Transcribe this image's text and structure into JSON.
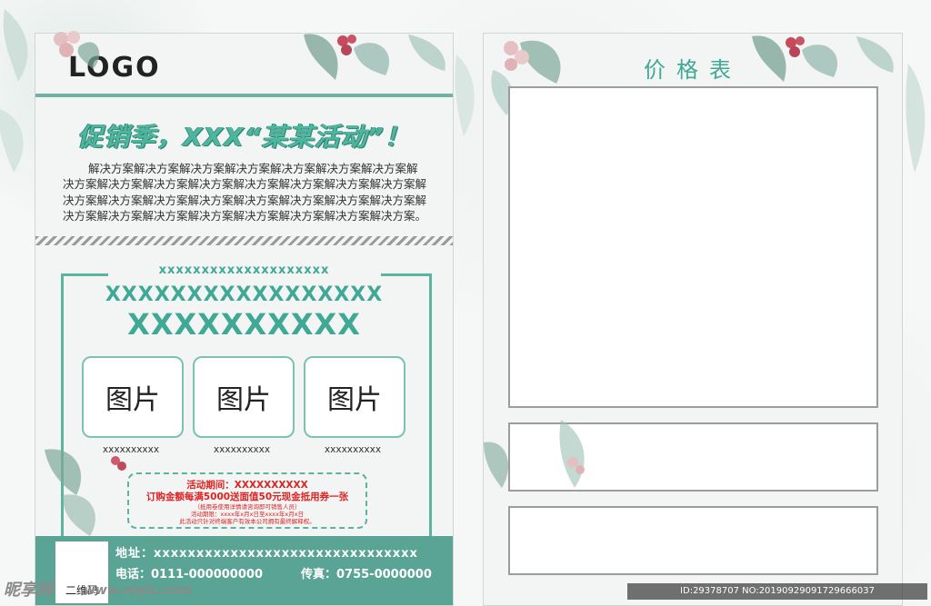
{
  "colors": {
    "accent": "#5bb3a0",
    "accent_dark": "#3fa995",
    "footer": "#5aa495",
    "coupon_text": "#dd2222"
  },
  "left": {
    "logo": "LOGO",
    "promo_title": "促销季，XXX“某某活动”！",
    "paragraph": "解决方案解决方案解决方案解决方案解决方案解决方案解决方案解决方案解决方案解决方案解决方案解决方案解决方案解决方案解决方案解决方案解决方案解决方案解决方案解决方案解决方案解决方案解决方案解决方案解决方案解决方案解决方案解决方案解决方案解决方案解决方案。",
    "x_line_1": "xxxxxxxxxxxxxxxxxxxx",
    "x_line_2": "XXXXXXXXXXXXXXXXX",
    "x_line_3": "XXXXXXXXXX",
    "pictures": [
      {
        "label": "图片",
        "caption": "xxxxxxxxxx"
      },
      {
        "label": "图片",
        "caption": "xxxxxxxxxx"
      },
      {
        "label": "图片",
        "caption": "xxxxxxxxxx"
      }
    ],
    "coupon": {
      "line1": "活动期间：XXXXXXXXXX",
      "line2": "订购金额每满5000送面值50元现金抵用券一张",
      "line3": "（抵用卷使用详情请咨询即可销售人员）",
      "line4": "活动期限：xxxx年x月x日至xxxx年x月x日",
      "line5": "此活动只针对终端客户有效本公司拥有最终解释权。"
    },
    "footer": {
      "qr_label": "二维码",
      "address": "地址：xxxxxxxxxxxxxxxxxxxxxxxxxxxxxxx",
      "phone": "电话：0111-000000000",
      "fax": "传真：0755-0000000"
    }
  },
  "right": {
    "title": "价格表"
  },
  "watermark": {
    "site_logo": "昵享网",
    "url": "www.nipic.com",
    "id_text": "ID:29378707 NO:20190929091729666037"
  }
}
